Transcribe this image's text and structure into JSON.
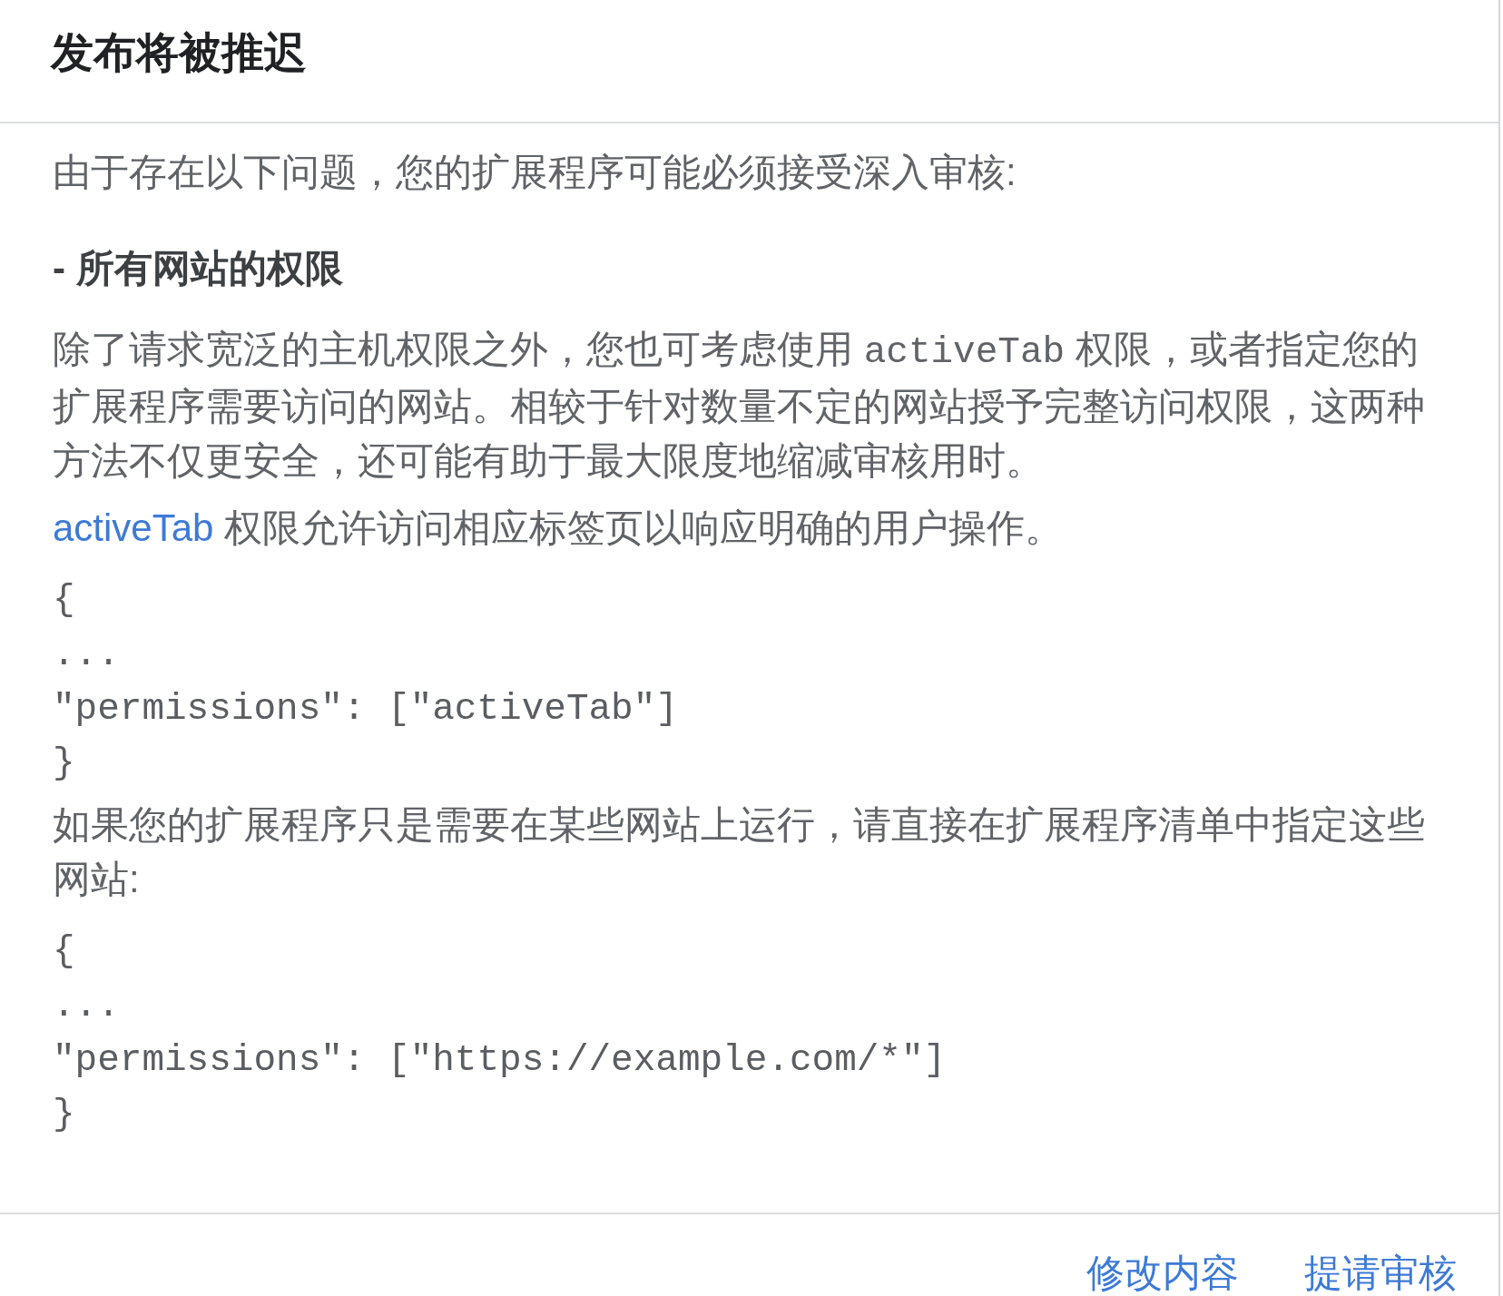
{
  "dialog": {
    "title": "发布将被推迟"
  },
  "content": [
    {
      "kind": "text",
      "text": "由于存在以下问题，您的扩展程序可能必须接受深入审核:"
    },
    {
      "kind": "heading",
      "text": "- 所有网站的权限"
    },
    {
      "kind": "paragraph",
      "segments": [
        {
          "kind": "text",
          "text": "除了请求宽泛的主机权限之外，您也可考虑使用 "
        },
        {
          "kind": "code",
          "text": "activeTab"
        },
        {
          "kind": "text",
          "text": " 权限，或者指定您的扩展程序需要访问的网站。相较于针对数量不定的网站授予完整访问权限，这两种方法不仅更安全，还可能有助于最大限度地缩减审核用时。"
        }
      ]
    },
    {
      "kind": "paragraph",
      "segments": [
        {
          "kind": "link",
          "text": "activeTab"
        },
        {
          "kind": "text",
          "text": " 权限允许访问相应标签页以响应明确的用户操作。"
        }
      ]
    },
    {
      "kind": "code",
      "lines": [
        "{",
        "...",
        "\"permissions\": [\"activeTab\"]",
        "}"
      ]
    },
    {
      "kind": "text",
      "text": "如果您的扩展程序只是需要在某些网站上运行，请直接在扩展程序清单中指定这些网站:"
    },
    {
      "kind": "code",
      "lines": [
        "{",
        "...",
        "\"permissions\": [\"https://example.com/*\"]",
        "}"
      ]
    }
  ],
  "buttons": [
    {
      "label": "修改内容"
    },
    {
      "label": "提请审核"
    }
  ]
}
